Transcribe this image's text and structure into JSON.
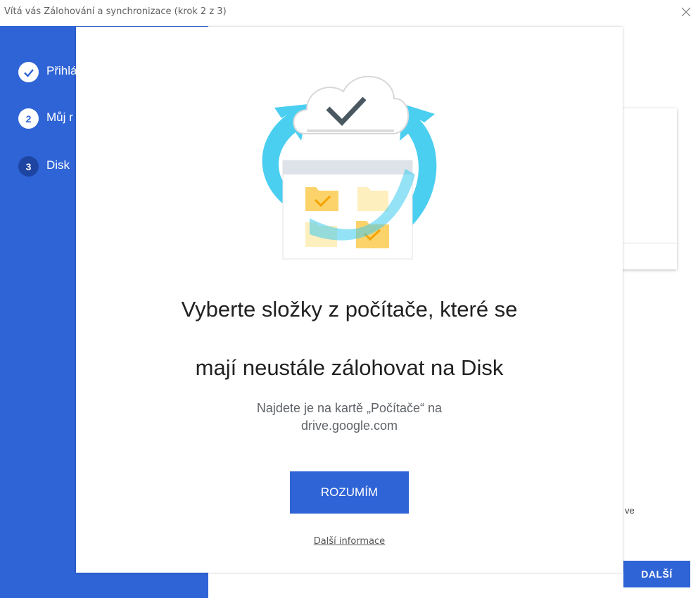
{
  "window": {
    "title": "Vítá vás Zálohování a synchronizace (krok 2 z 3)"
  },
  "sidebar": {
    "steps": [
      {
        "number": "",
        "label": "Přihlá",
        "state": "done"
      },
      {
        "number": "2",
        "label": "Můj r",
        "state": "pending"
      },
      {
        "number": "3",
        "label": "Disk",
        "state": "active"
      }
    ]
  },
  "background": {
    "partial_text": "ř ve",
    "next_button": "DALŠÍ"
  },
  "modal": {
    "heading_line1": "Vyberte složky z počítače, které se",
    "heading_line2": "mají neustále zálohovat na Disk",
    "subtitle_line1": "Najdete je na kartě „Počítače“ na",
    "subtitle_line2": "drive.google.com",
    "ok_button": "ROZUMÍM",
    "more_info_link": "Další informace"
  },
  "colors": {
    "accent": "#2f64d6",
    "sidebar": "#2f64d6",
    "arrow": "#3ccbef",
    "folder": "#fde9a9",
    "check": "#f5b400"
  },
  "icons": [
    "close-icon",
    "checkmark-icon",
    "cloud-check-icon",
    "sync-arrow-icon",
    "folder-icon"
  ]
}
